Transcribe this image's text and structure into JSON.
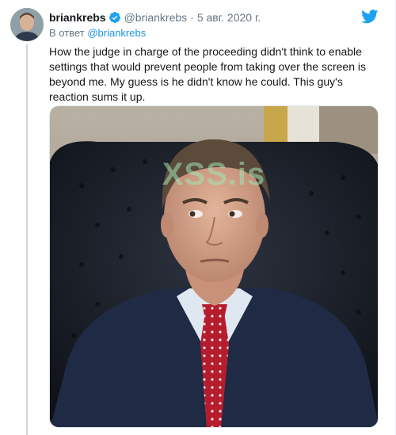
{
  "tweet": {
    "author_name": "briankrebs",
    "author_handle": "@briankrebs",
    "separator": "·",
    "date": "5 авг. 2020 г.",
    "reply_prefix": "В ответ",
    "reply_handle": "@briankrebs",
    "text": "How the judge in charge of the proceeding didn't think to enable settings that would prevent people from taking over the screen is beyond me. My guess is he didn't know he could. This guy's reaction sums it up.",
    "media": {
      "watermark": "XSS.is"
    }
  },
  "icons": {
    "verified": "verified-badge-icon",
    "brand": "twitter-bird-icon"
  },
  "colors": {
    "brand": "#1da1f2",
    "link": "#1b95e0",
    "secondary_text": "#657786",
    "thread_line": "#ccd6dd"
  }
}
